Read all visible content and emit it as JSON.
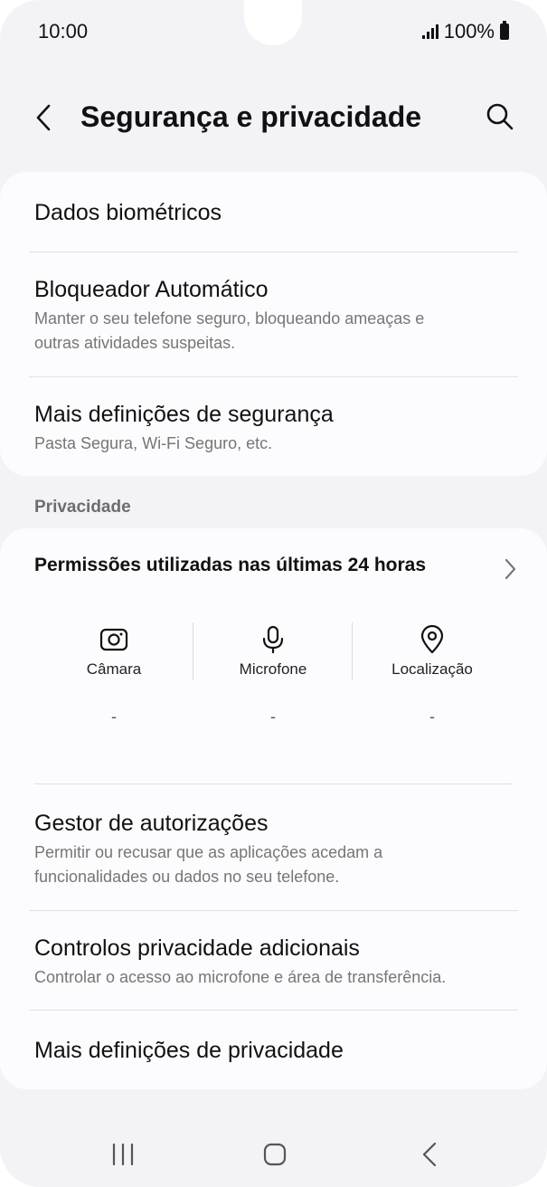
{
  "status": {
    "time": "10:00",
    "battery": "100%"
  },
  "header": {
    "title": "Segurança e privacidade"
  },
  "security": {
    "items": [
      {
        "title": "Dados biométricos"
      },
      {
        "title": "Bloqueador Automático",
        "subtitle_line1": "Manter o seu telefone seguro, bloqueando ameaças e",
        "subtitle_line2": "outras atividades suspeitas."
      },
      {
        "title": "Mais definições de segurança",
        "subtitle": "Pasta Segura, Wi-Fi Seguro, etc."
      }
    ]
  },
  "privacy": {
    "section_label": "Privacidade",
    "permissions": {
      "title": "Permissões utilizadas nas últimas 24 horas",
      "columns": [
        {
          "label": "Câmara",
          "value": "-",
          "icon": "camera-icon"
        },
        {
          "label": "Microfone",
          "value": "-",
          "icon": "microphone-icon"
        },
        {
          "label": "Localização",
          "value": "-",
          "icon": "location-pin-icon"
        }
      ]
    },
    "items": [
      {
        "title": "Gestor de autorizações",
        "subtitle_line1": "Permitir ou recusar que as aplicações acedam a",
        "subtitle_line2": "funcionalidades ou dados no seu telefone."
      },
      {
        "title": "Controlos privacidade adicionais",
        "subtitle": "Controlar o acesso ao microfone e área de transferência."
      },
      {
        "title": "Mais definições de privacidade"
      }
    ]
  },
  "nav": {
    "icons": [
      "recent-apps-icon",
      "home-icon",
      "back-icon"
    ]
  }
}
